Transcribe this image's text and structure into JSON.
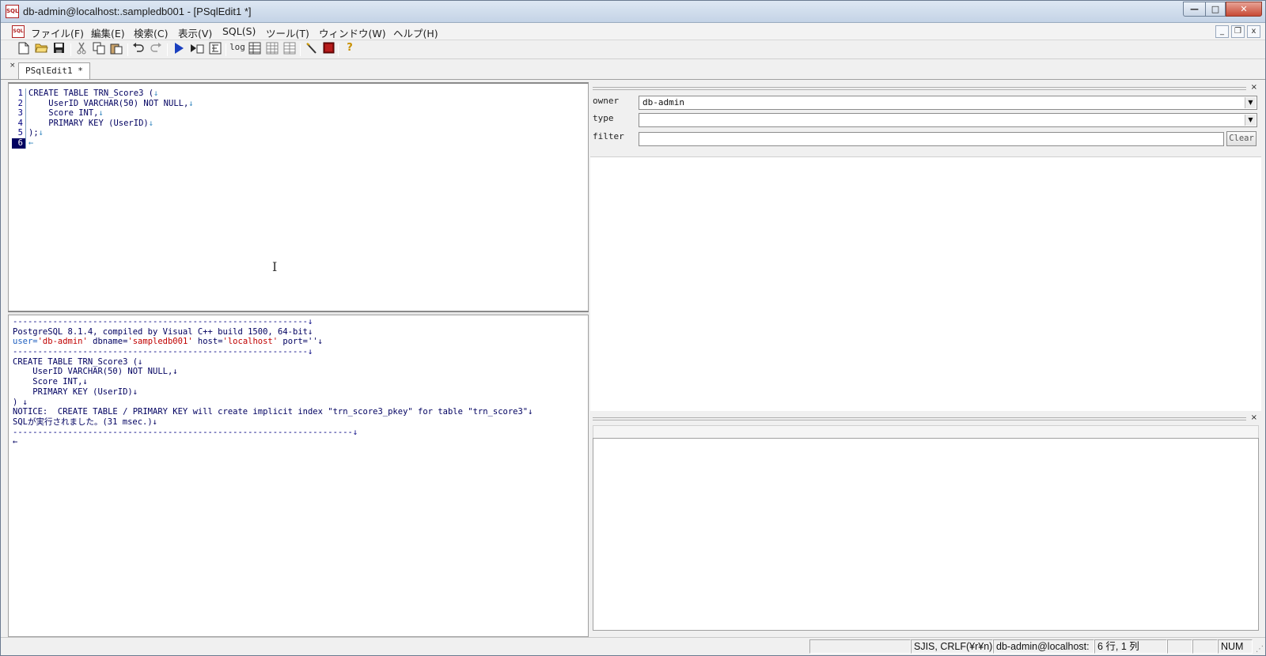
{
  "window": {
    "title": "db-admin@localhost:.sampledb001 - [PSqlEdit1 *]",
    "app_icon": "SQL",
    "minimize_label": "—",
    "maximize_label": "□",
    "close_label": "✕"
  },
  "menubar": {
    "items": [
      "ファイル(F)",
      "編集(E)",
      "検索(C)",
      "表示(V)",
      "SQL(S)",
      "ツール(T)",
      "ウィンドウ(W)",
      "ヘルプ(H)"
    ],
    "mdi_min": "_",
    "mdi_restore": "❐",
    "mdi_close": "x"
  },
  "toolbar": {
    "icons": [
      "new-file-icon",
      "open-folder-icon",
      "save-icon",
      "cut-icon",
      "copy-icon",
      "paste-icon",
      "undo-icon",
      "redo-icon",
      "run-icon",
      "run-step-icon",
      "explain-icon",
      "log-icon",
      "grid-icon",
      "grid2-icon",
      "grid3-icon",
      "wand-icon",
      "stop-icon",
      "help-icon"
    ],
    "log_label": "log"
  },
  "tabs": {
    "close_label": "×",
    "items": [
      {
        "label": "PSqlEdit1 *"
      }
    ]
  },
  "editor": {
    "lines": [
      {
        "num": "1",
        "text": "CREATE TABLE TRN_Score3 (",
        "eol": "↓"
      },
      {
        "num": "2",
        "text": "    UserID VARCHAR(50) NOT NULL,",
        "eol": "↓"
      },
      {
        "num": "3",
        "text": "    Score INT,",
        "eol": "↓"
      },
      {
        "num": "4",
        "text": "    PRIMARY KEY (UserID)",
        "eol": "↓"
      },
      {
        "num": "5",
        "text": ");",
        "eol": "↓"
      },
      {
        "num": "6",
        "text": "",
        "eol": "←"
      }
    ]
  },
  "log": {
    "dash_line_1": "-----------------------------------------------------------↓",
    "version_line": "PostgreSQL 8.1.4, compiled by Visual C++ build 1500, 64-bit↓",
    "conn_user_key": "user=",
    "conn_user_val": "'db-admin'",
    "conn_db_key": " dbname=",
    "conn_db_val": "'sampledb001'",
    "conn_host_key": " host=",
    "conn_host_val": "'localhost'",
    "conn_port": " port=''↓",
    "dash_line_2": "-----------------------------------------------------------↓",
    "sql_lines": [
      "CREATE TABLE TRN_Score3 (↓",
      "    UserID VARCHAR(50) NOT NULL,↓",
      "    Score INT,↓",
      "    PRIMARY KEY (UserID)↓",
      ") ↓"
    ],
    "notice_line": "NOTICE:  CREATE TABLE / PRIMARY KEY will create implicit index \"trn_score3_pkey\" for table \"trn_score3\"↓",
    "result_line": "SQLが実行されました。(31 msec.)↓",
    "dash_line_3": "--------------------------------------------------------------------↓",
    "end_marker": "←"
  },
  "object_browser": {
    "owner_label": "owner",
    "owner_value": "db-admin",
    "type_label": "type",
    "type_value": "",
    "filter_label": "filter",
    "filter_value": "",
    "clear_label": "Clear",
    "close_label": "×",
    "dropdown_arrow": "▼"
  },
  "status_bar": {
    "encoding": "SJIS, CRLF(¥r¥n)",
    "connection": "db-admin@localhost:",
    "position": "6 行, 1 列",
    "num": "NUM"
  }
}
